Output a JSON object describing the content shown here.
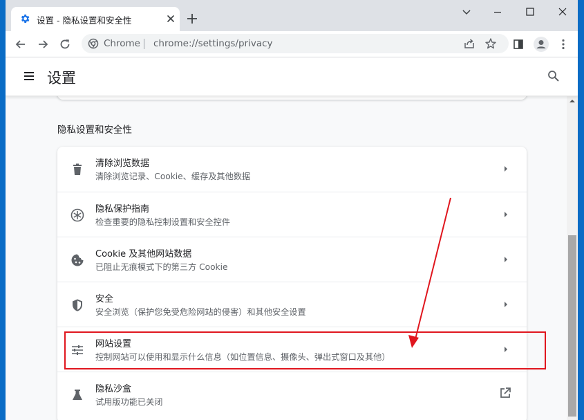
{
  "browser": {
    "tab_title": "设置 - 隐私设置和安全性",
    "omnibox_site": "Chrome",
    "omnibox_url": "chrome://settings/privacy"
  },
  "header": {
    "title": "设置"
  },
  "section": {
    "title": "隐私设置和安全性",
    "rows": [
      {
        "title": "清除浏览数据",
        "subtitle": "清除浏览记录、Cookie、缓存及其他数据",
        "icon": "trash-icon"
      },
      {
        "title": "隐私保护指南",
        "subtitle": "检查重要的隐私控制设置和安全控件",
        "icon": "privacy-guide-icon"
      },
      {
        "title": "Cookie 及其他网站数据",
        "subtitle": "已阻止无痕模式下的第三方 Cookie",
        "icon": "cookie-icon"
      },
      {
        "title": "安全",
        "subtitle": "安全浏览（保护您免受危险网站的侵害）和其他安全设置",
        "icon": "shield-icon"
      },
      {
        "title": "网站设置",
        "subtitle": "控制网站可以使用和显示什么信息（如位置信息、摄像头、弹出式窗口及其他）",
        "icon": "tune-icon"
      },
      {
        "title": "隐私沙盒",
        "subtitle": "试用版功能已关闭",
        "icon": "flask-icon"
      }
    ]
  },
  "colors": {
    "accent": "#1a73e8",
    "annotation": "#e0161e",
    "desktop": "#0a6cc5"
  }
}
